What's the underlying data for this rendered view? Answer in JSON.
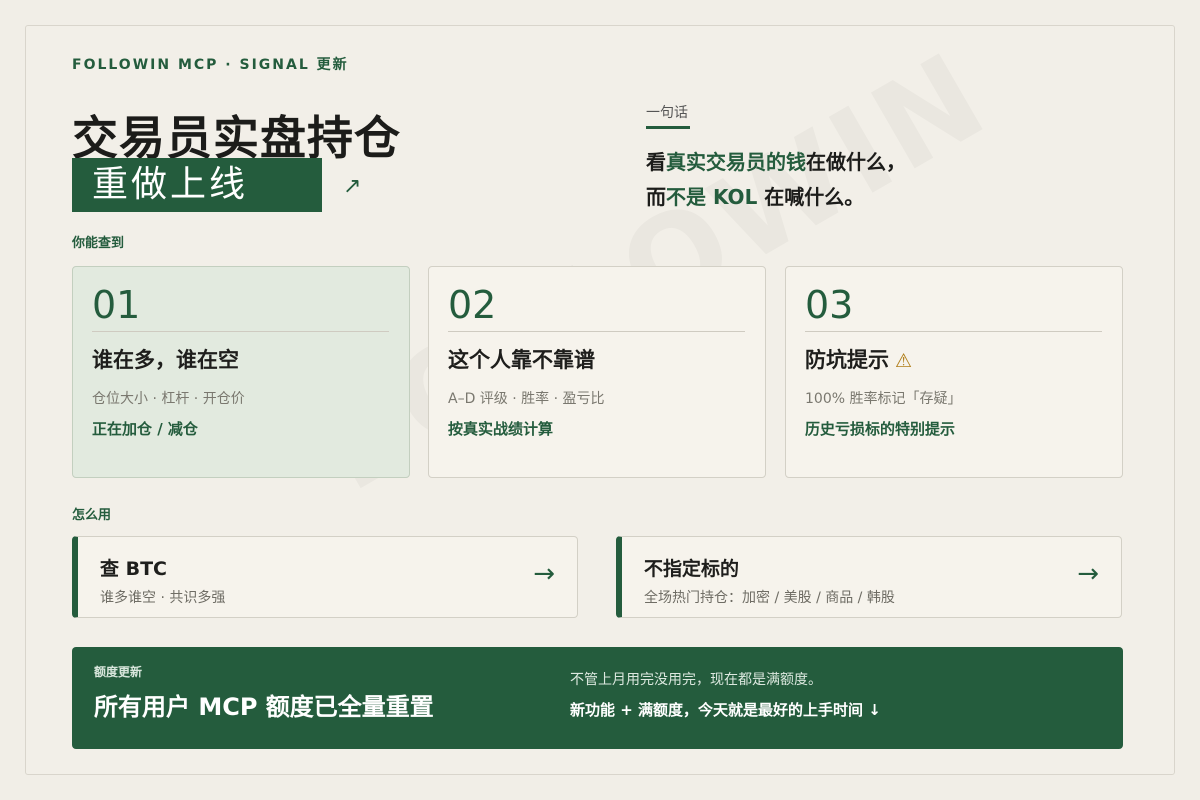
{
  "eyebrow": "FOLLOWIN MCP · SIGNAL 更新",
  "watermark": "FOLLOWIN",
  "headline": {
    "title": "交易员实盘持仓",
    "highlight": "重做上线",
    "arrow": "↗"
  },
  "one_liner": {
    "label": "一句话",
    "line1_pre": "看",
    "line1_em": "真实交易员的钱",
    "line1_post": "在做什么，",
    "line2_pre": "而",
    "line2_em": "不是 KOL",
    "line2_post": " 在喊什么。"
  },
  "section_find": "你能查到",
  "cards": [
    {
      "num": "01",
      "title": "谁在多，谁在空",
      "sub": "仓位大小 · 杠杆 · 开仓价",
      "note": "正在加仓 / 减仓",
      "warn": ""
    },
    {
      "num": "02",
      "title": "这个人靠不靠谱",
      "sub": "A–D 评级 · 胜率 · 盈亏比",
      "note": "按真实战绩计算",
      "warn": ""
    },
    {
      "num": "03",
      "title": "防坑提示",
      "sub": "100% 胜率标记「存疑」",
      "note": "历史亏损标的特别提示",
      "warn": "⚠"
    }
  ],
  "section_howto": "怎么用",
  "howto": [
    {
      "title": "查 BTC",
      "sub": "谁多谁空 · 共识多强",
      "arrow": "→"
    },
    {
      "title": "不指定标的",
      "sub": "全场热门持仓：加密 / 美股 / 商品 / 韩股",
      "arrow": "→"
    }
  ],
  "banner": {
    "label": "额度更新",
    "title": "所有用户 MCP 额度已全量重置",
    "note1": "不管上月用完没用完，现在都是满额度。",
    "note2": "新功能 + 满额度，今天就是最好的上手时间 ↓"
  },
  "colors": {
    "accent": "#245c3d",
    "background": "#f1eee7",
    "card_bg": "#f6f3ec",
    "card_tinted_bg": "#e2eadf",
    "warning": "#b07d18"
  }
}
